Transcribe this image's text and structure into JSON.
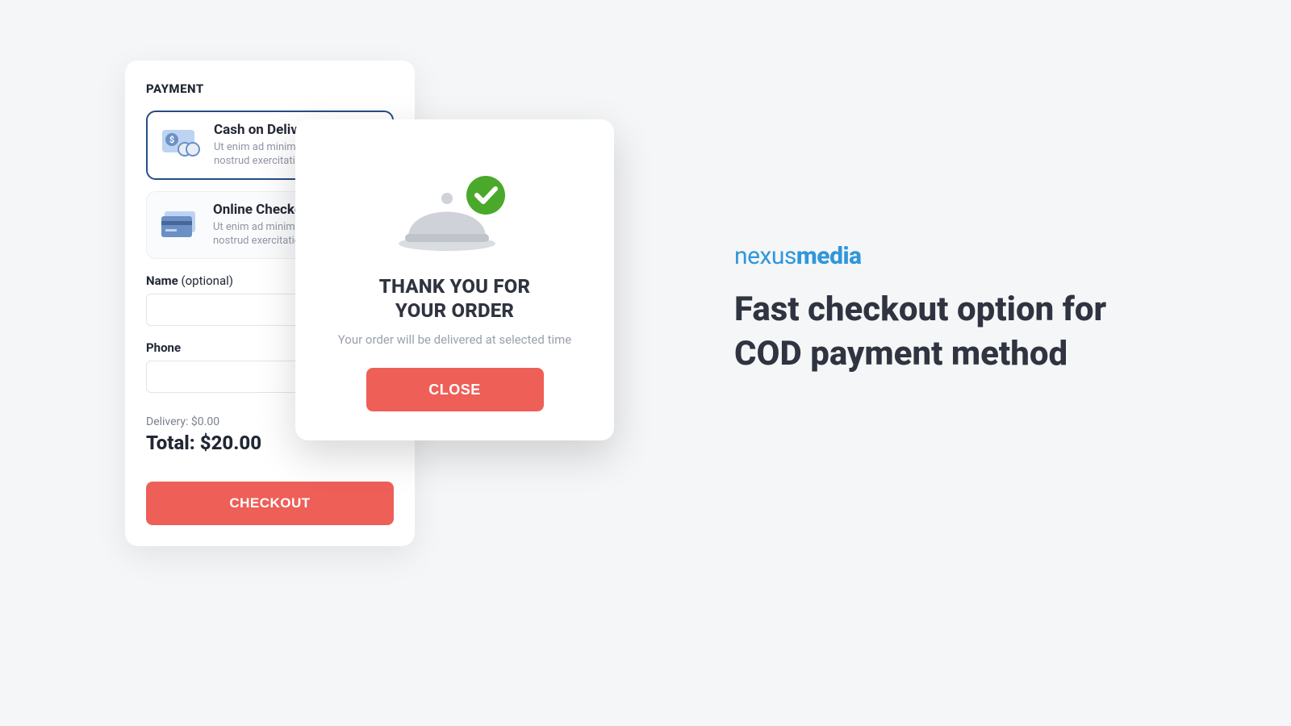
{
  "payment": {
    "title": "PAYMENT",
    "methods": [
      {
        "name": "Cash on Delivery",
        "desc": "Ut enim ad minim veniam, quis nostrud exercitation"
      },
      {
        "name": "Online Checkout",
        "desc": "Ut enim ad minim veniam, quis nostrud exercitation"
      }
    ],
    "name_label": "Name",
    "name_optional": "(optional)",
    "phone_label": "Phone",
    "delivery_label": "Delivery:",
    "delivery_value": "$0.00",
    "total_label": "Total:",
    "total_value": "$20.00",
    "checkout_button": "CHECKOUT"
  },
  "modal": {
    "title_line1": "THANK YOU FOR",
    "title_line2": "YOUR ORDER",
    "subtitle": "Your order will be delivered at selected time",
    "close_button": "CLOSE"
  },
  "marketing": {
    "brand_part1": "nexus",
    "brand_part2": "media",
    "headline": "Fast checkout option for COD payment method"
  },
  "colors": {
    "primary_border": "#274c86",
    "accent": "#ee5f58",
    "brand_blue": "#2f97db",
    "success": "#4aa92b"
  }
}
